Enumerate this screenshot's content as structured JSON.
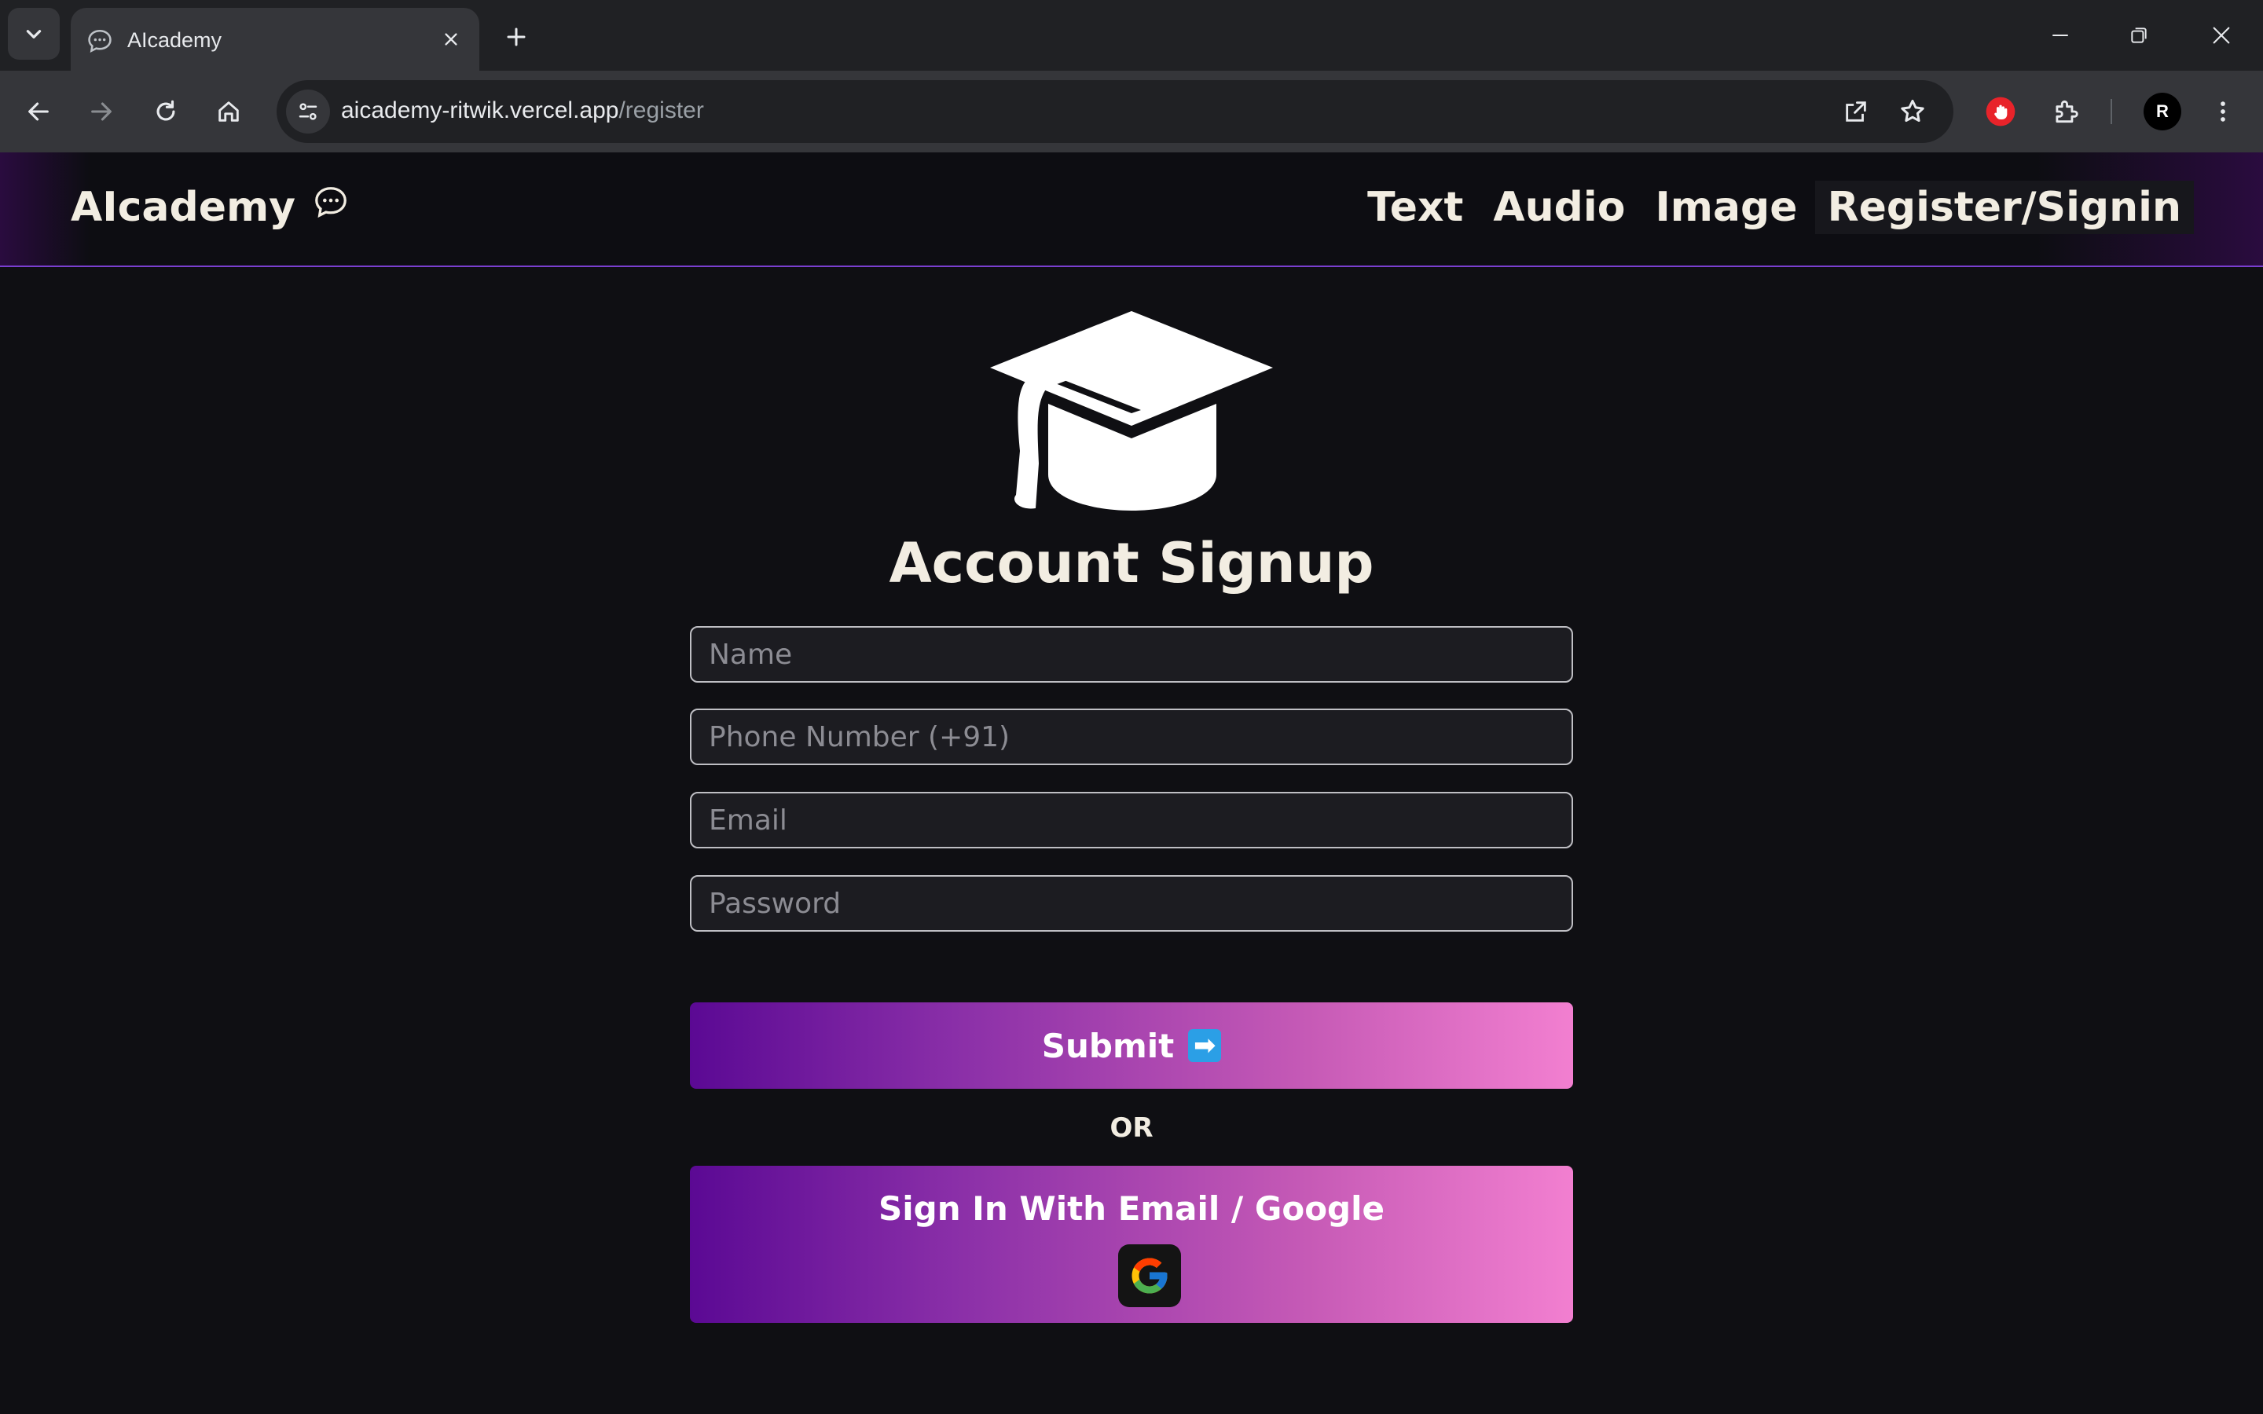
{
  "browser": {
    "tab_title": "AIcademy",
    "url_host": "aicademy-ritwik.vercel.app",
    "url_path": "/register",
    "profile_initial": "R"
  },
  "site": {
    "brand": "AIcademy",
    "nav": {
      "text": "Text",
      "audio": "Audio",
      "image": "Image",
      "register": "Register/Signin"
    }
  },
  "signup": {
    "title": "Account Signup",
    "name_placeholder": "Name",
    "phone_placeholder": "Phone Number (+91)",
    "email_placeholder": "Email",
    "password_placeholder": "Password",
    "submit_label": "Submit",
    "submit_arrow": "➡",
    "or_text": "OR",
    "google_label": "Sign In With Email / Google"
  },
  "colors": {
    "background": "#0f0f13",
    "gradient_start": "#5b0994",
    "gradient_end": "#f27fd0",
    "nav_border": "#7a3fd0"
  },
  "icons": [
    "chevron-down-icon",
    "chat-icon",
    "close-icon",
    "plus-icon",
    "minimize-icon",
    "restore-icon",
    "back-icon",
    "forward-icon",
    "reload-icon",
    "home-icon",
    "tune-icon",
    "open-external-icon",
    "star-icon",
    "hand-stop-icon",
    "puzzle-icon",
    "more-vert-icon",
    "graduation-cap-icon",
    "google-icon"
  ]
}
